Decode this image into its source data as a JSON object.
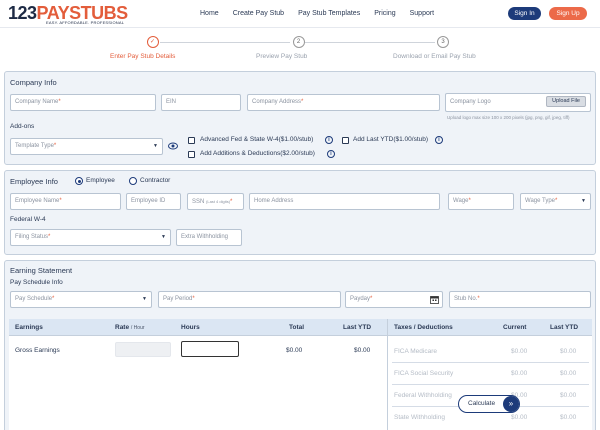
{
  "header": {
    "logo_num": "123",
    "logo_brand": "PAYSTUBS",
    "logo_tagline": "EASY. AFFORDABLE. PROFESSIONAL",
    "nav": [
      "Home",
      "Create Pay Stub",
      "Pay Stub Templates",
      "Pricing",
      "Support"
    ],
    "signin_label": "Sign In",
    "signup_label": "Sign Up"
  },
  "stepper": {
    "steps": [
      {
        "num": "✓",
        "label": "Enter Pay Stub Details"
      },
      {
        "num": "2",
        "label": "Preview Pay Stub"
      },
      {
        "num": "3",
        "label": "Download or Email Pay Stub"
      }
    ]
  },
  "company": {
    "title": "Company Info",
    "name_placeholder": "Company Name",
    "ein_placeholder": "EIN",
    "address_placeholder": "Company Address",
    "logo_placeholder": "Company Logo",
    "upload_label": "Upload File",
    "upload_hint": "Upload logo max size 100 x 200 pixels (jpg, png, gif, jpeg, tiff)",
    "addons_label": "Add-ons",
    "template_placeholder": "Template Type",
    "addon_fed_state": "Advanced Fed & State W-4($1.00/stub)",
    "addon_ytd": "Add Last YTD($1.00/stub)",
    "addon_deductions": "Add Additions & Deductions($2.00/stub)"
  },
  "employee": {
    "title": "Employee Info",
    "type_employee": "Employee",
    "type_contractor": "Contractor",
    "name_placeholder": "Employee Name",
    "id_placeholder": "Employee ID",
    "ssn_placeholder": "SSN",
    "ssn_hint": "(Last 4 digits)",
    "address_placeholder": "Home Address",
    "wage_placeholder": "Wage",
    "wage_type_placeholder": "Wage Type",
    "federal_label": "Federal W-4",
    "filing_placeholder": "Filing Status",
    "extra_placeholder": "Extra Withholding"
  },
  "earnings": {
    "title": "Earning Statement",
    "schedule_label": "Pay Schedule Info",
    "schedule_placeholder": "Pay Schedule",
    "period_placeholder": "Pay Period",
    "payday_placeholder": "Payday",
    "stub_placeholder": "Stub No.",
    "cols": {
      "earnings": "Earnings",
      "rate": "Rate",
      "rate_sub": "/ Hour",
      "hours": "Hours",
      "total": "Total",
      "ytd": "Last YTD"
    },
    "row_label": "Gross Earnings",
    "row_total": "$0.00",
    "row_ytd": "$0.00"
  },
  "taxes": {
    "cols": {
      "label": "Taxes / Deductions",
      "current": "Current",
      "ytd": "Last YTD"
    },
    "rows": [
      {
        "label": "FICA Medicare",
        "current": "$0.00",
        "ytd": "$0.00"
      },
      {
        "label": "FICA Social Security",
        "current": "$0.00",
        "ytd": "$0.00"
      },
      {
        "label": "Federal Withholding",
        "current": "$0.00",
        "ytd": "$0.00"
      },
      {
        "label": "State Withholding",
        "current": "$0.00",
        "ytd": "$0.00"
      }
    ],
    "calculate_label": "Calculate"
  },
  "colors": {
    "brand": "#e35d3b",
    "navy": "#1d3b7a",
    "panel": "#eff3f8"
  }
}
